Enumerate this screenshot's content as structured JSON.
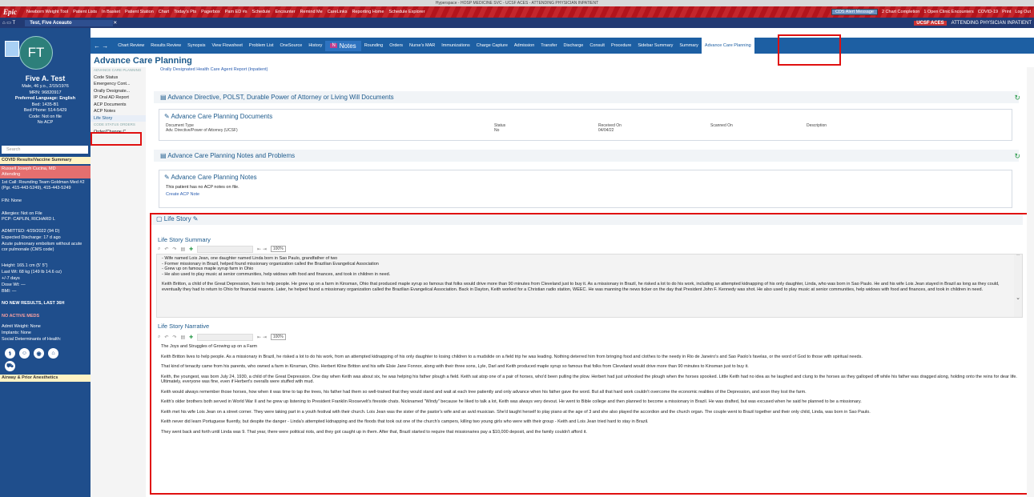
{
  "window": {
    "title": "Hyperspace - HOSP MEDICINE SVC - UCSF ACES - ATTENDING PHYSICIAN INPATIENT"
  },
  "epic_toolbar": {
    "logo": "Epic",
    "items": [
      "Newborn Weight Tool",
      "Patient Lists",
      "In Basket",
      "Patient Station",
      "Chart",
      "Today's Pts",
      "Pagerbox",
      "Pam ED #s",
      "Schedule",
      "Encounter",
      "Remind Me",
      "CareLinks",
      "Reporting Home",
      "Schedule Explorer"
    ],
    "alert": "CDS Alert Message",
    "chart_completion": "2 Chart Completion",
    "open_enc": "1 Open Clinic Encounters",
    "right": [
      "COVID-19",
      "Print",
      "Log Out"
    ]
  },
  "patient_tab": {
    "label": "Test, Five Aceauto",
    "role_badge": "UCSF ACES",
    "role_text": "ATTENDING PHYSICIAN INPATIENT"
  },
  "patient": {
    "initials": "FT",
    "name": "Five A. Test",
    "demographics": "Male, 46 y.o., 2/15/1976",
    "mrn": "MRN: 96820917",
    "language": "Preferred Language: English",
    "bed": "Bed: 1435-B1",
    "bed_phone": "Bed Phone: 514-5429",
    "code": "Code: Not on file",
    "acp": "No ACP"
  },
  "sidebar": {
    "search_placeholder": "Search",
    "covid": "COVID Results/Vaccine Summary",
    "attending": "Russell Joseph Cucina, MD",
    "attending_role": "Attending",
    "first_call": "1st Call: Rounding Team Goldman Med #2 (Pgr. 415-443-5249), 415-443-5249",
    "fin": "FIN: None",
    "allergies": "Allergies: Not on File",
    "pcp": "PCP: CAPLIN, RICHARD L",
    "admitted": "ADMITTED: 4/29/2022 (94 D)",
    "expected": "Expected Discharge: 17 d ago",
    "dx1": "Acute pulmonary embolism without acute cor pulmonale (CMS code)",
    "height": "Height: 165.1 cm (5' 5\")",
    "weight": "Last Wt: 68 kg (149 lb 14.6 oz)",
    "wt_delta": "+/-7 days",
    "dose_wt": "Dose Wt: —",
    "bmi": "BMI: —",
    "new_results": "NO NEW RESULTS, LAST 36H",
    "active_meds": "NO ACTIVE MEDS",
    "admit_weight": "Admit Weight: None",
    "implants": "Implants: None",
    "sdoh": "Social Determinants of Health:",
    "airway": "Airway & Prior Anesthetics"
  },
  "activity_tabs": [
    "Chart Review",
    "Results Review",
    "Synopsis",
    "View Flowsheet",
    "Problem List",
    "OneSource",
    "History",
    "Notes",
    "Rounding",
    "Orders",
    "Nurse's MAR",
    "Immunizations",
    "Charge Capture",
    "Admission",
    "Transfer",
    "Discharge",
    "Consult",
    "Procedure",
    "Sidebar Summary",
    "Summary",
    "Advance Care Planning"
  ],
  "page": {
    "title": "Advance Care Planning"
  },
  "toc": {
    "header1": "ADVANCE CARE PLANNING",
    "items": [
      "Code Status",
      "Emergency Cont...",
      "Orally Designate...",
      "IP Oral AD Report",
      "ACP Documents",
      "ACP Notes",
      "Life Story"
    ],
    "header2": "CODE STATUS ORDERS",
    "items2": [
      "Order/Change C..."
    ]
  },
  "acp_link": "Orally Designated Health Care Agent Report (Inpatient)",
  "advance_directive": {
    "title": "Advance Directive, POLST, Durable Power of Attorney or Living Will Documents",
    "card_title": "Advance Care Planning Documents",
    "columns": [
      "Document Type",
      "Status",
      "Received On",
      "Scanned On",
      "Description"
    ],
    "row": [
      "Adv. Directive/Power of Attorney (UCSF)",
      "No",
      "04/04/22",
      "",
      ""
    ]
  },
  "acp_notes_section": {
    "title": "Advance Care Planning Notes and Problems",
    "card_title": "Advance Care Planning Notes",
    "empty": "This patient has no ACP notes on file.",
    "create": "Create ACP Note"
  },
  "life_story": {
    "title": "Life Story",
    "summary_label": "Life Story Summary",
    "narrative_label": "Life Story Narrative",
    "zoom": "100%",
    "summary_bullets": [
      "- Wife named Lois Jean, one daughter named Linda born in Sao Paulo, grandfather of two",
      "- Former missionary in Brazil, helped found missionary organization called the Brazilian Evangelical Association",
      "- Grew up on famous maple syrup farm in Ohio",
      "- He also used to play music at senior communities, help widows with food and finances, and took in children in need."
    ],
    "summary_para": "Keith Britton, a child of the Great Depression, lives to help people. He grew up on a farm in Kinsman, Ohio that produced maple syrup so famous that folks would drive more than 90 minutes from Cleveland just to buy it.  As a missionary in Brazil, he risked a lot to do his work, including an attempted kidnapping of his only daughter, Linda, who was born in Sao Paulo. He and his wife Lois Jean stayed in Brazil as long as they could, eventually they had to return to Ohio for financial reasons. Later, he helped found a missionary organization called the Brazilian Evangelical Association. Back in Dayton, Keith worked for a Christian radio station, WEEC. He was manning the news ticker on the day that President John F. Kennedy was shot. He also used to play music at senior communities, help widows with food and finances, and took in children in need.",
    "narrative_heading": "The Joys and Struggles of Growing up on a Farm",
    "narrative": [
      "Keith Britton lives to help people. As a missionary in Brazil, he risked a lot to do his work, from an attempted kidnapping of his only daughter to losing children to a mudslide on a field trip he was leading. Nothing deterred him from bringing food and clothes to the needy in Rio de Janeiro's and Sao Paolo's favelas, or the word of God to those with spiritual needs.",
      "That kind of tenacity came from his parents, who owned a farm in Kinsman, Ohio. Herbert Kline Britton and his wife Elsie Jane Fonnor, along with their three sons, Lyle, Darl and Keith produced maple syrup so famous that folks from Cleveland would drive more than 90 minutes to Kinsman just to buy it.",
      "Keith, the youngest, was born July 24, 1930, a child of the Great Depression. One day when Keith was about six, he was helping his father plough a field. Keith sat atop one of a pair of horses, who'd been pulling the plow. Herbert had just unhooked the plough when the horses spooked. Little Keith had no idea as he laughed and clung to the horses as they galloped off while his father was dragged along, holding onto the reins for dear life. Ultimately, everyone was fine, even if Herbert's overalls were stuffed with mud.",
      "Keith would always remember those horses, how when it was time to tap the trees, his father had them so well-trained that they would stand and wait at each tree patiently and only advance when his father gave the word. But all that hard work couldn't overcome the economic realities of the Depression, and soon they lost the farm.",
      "Keith's older brothers both served in World War II and he grew up listening to President Franklin Roosevelt's fireside chats. Nicknamed \"Windy\" because he liked to talk a lot, Keith was always very devout. He went to Bible college and then planned to become a missionary in Brazil. He was drafted, but was excused when he said he planned to be a missionary.",
      "Keith met his wife Lois Jean on a street corner. They were taking part in a youth festival with their church. Lois Jean was the sister of the pastor's wife and an avid musician. She'd taught herself to play piano at the age of 3 and she also played the accordion and the church organ. The couple went to Brazil together and their only child, Linda, was born in Sao Paulo.",
      "Keith never did learn Portuguese fluently, but despite the danger - Linda's attempted kidnapping and the floods that took out one of the church's campers, killing two young girls who were with their group - Keith and Lois Jean tried hard to stay in Brazil.",
      "They went back and forth until Linda was 9. That year, there were political riots, and they got caught up in them. After that, Brazil started to require that missionaries pay a $10,000 deposit, and the family couldn't afford it."
    ]
  },
  "colors": {
    "epic_red": "#b3141c",
    "nav_blue": "#1f4e8c",
    "tab_blue": "#1d5fa3",
    "highlight": "#e01010"
  }
}
